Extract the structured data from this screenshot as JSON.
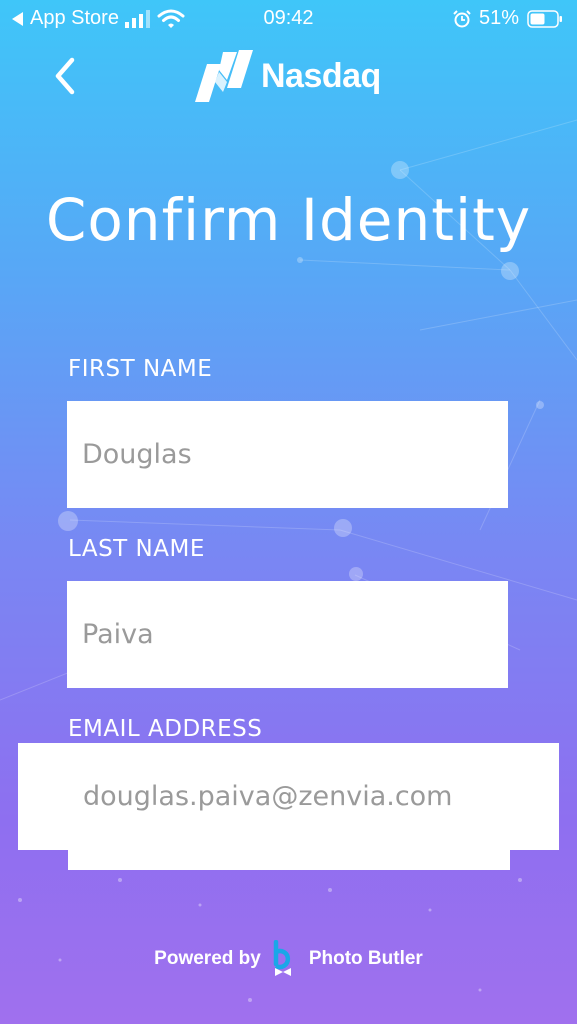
{
  "status_bar": {
    "back_app": "App Store",
    "time": "09:42",
    "battery": "51%"
  },
  "header": {
    "logo_text": "Nasdaq"
  },
  "page": {
    "title": "Confirm Identity"
  },
  "form": {
    "first_name": {
      "label": "FIRST NAME",
      "value": "Douglas"
    },
    "last_name": {
      "label": "LAST NAME",
      "value": "Paiva"
    },
    "email": {
      "label": "EMAIL ADDRESS",
      "value": "douglas.paiva@zenvia.com"
    }
  },
  "footer": {
    "powered_by": "Powered by",
    "brand": "Photo Butler"
  },
  "colors": {
    "gradient_top": "#3fc6f9",
    "gradient_bottom": "#a070ee"
  }
}
